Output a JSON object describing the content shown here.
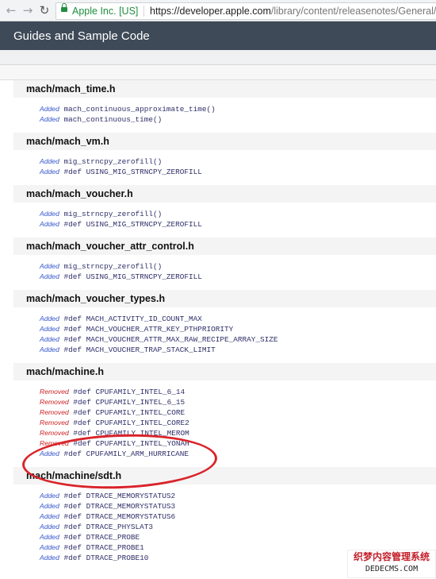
{
  "browser": {
    "secure_label": "Apple Inc. [US]",
    "url_scheme": "https://",
    "url_host": "developer.apple.com",
    "url_rest": "/library/content/releasenotes/General/A",
    "icons": {
      "back": "back-arrow-icon",
      "forward": "forward-arrow-icon",
      "reload": "reload-icon",
      "lock": "lock-icon"
    }
  },
  "header": {
    "title": "Guides and Sample Code"
  },
  "sections": [
    {
      "title": "mach/mach_time.h",
      "entries": [
        {
          "status": "Added",
          "text": "mach_continuous_approximate_time()"
        },
        {
          "status": "Added",
          "text": "mach_continuous_time()"
        }
      ]
    },
    {
      "title": "mach/mach_vm.h",
      "entries": [
        {
          "status": "Added",
          "text": "mig_strncpy_zerofill()"
        },
        {
          "status": "Added",
          "text": "#def USING_MIG_STRNCPY_ZEROFILL"
        }
      ]
    },
    {
      "title": "mach/mach_voucher.h",
      "entries": [
        {
          "status": "Added",
          "text": "mig_strncpy_zerofill()"
        },
        {
          "status": "Added",
          "text": "#def USING_MIG_STRNCPY_ZEROFILL"
        }
      ]
    },
    {
      "title": "mach/mach_voucher_attr_control.h",
      "entries": [
        {
          "status": "Added",
          "text": "mig_strncpy_zerofill()"
        },
        {
          "status": "Added",
          "text": "#def USING_MIG_STRNCPY_ZEROFILL"
        }
      ]
    },
    {
      "title": "mach/mach_voucher_types.h",
      "entries": [
        {
          "status": "Added",
          "text": "#def MACH_ACTIVITY_ID_COUNT_MAX"
        },
        {
          "status": "Added",
          "text": "#def MACH_VOUCHER_ATTR_KEY_PTHPRIORITY"
        },
        {
          "status": "Added",
          "text": "#def MACH_VOUCHER_ATTR_MAX_RAW_RECIPE_ARRAY_SIZE"
        },
        {
          "status": "Added",
          "text": "#def MACH_VOUCHER_TRAP_STACK_LIMIT"
        }
      ]
    },
    {
      "title": "mach/machine.h",
      "entries": [
        {
          "status": "Removed",
          "text": "#def CPUFAMILY_INTEL_6_14"
        },
        {
          "status": "Removed",
          "text": "#def CPUFAMILY_INTEL_6_15"
        },
        {
          "status": "Removed",
          "text": "#def CPUFAMILY_INTEL_CORE"
        },
        {
          "status": "Removed",
          "text": "#def CPUFAMILY_INTEL_CORE2"
        },
        {
          "status": "Removed",
          "text": "#def CPUFAMILY_INTEL_MEROM"
        },
        {
          "status": "Removed",
          "text": "#def CPUFAMILY_INTEL_YONAH"
        },
        {
          "status": "Added",
          "text": "#def CPUFAMILY_ARM_HURRICANE"
        }
      ]
    },
    {
      "title": "mach/machine/sdt.h",
      "entries": [
        {
          "status": "Added",
          "text": "#def DTRACE_MEMORYSTATUS2"
        },
        {
          "status": "Added",
          "text": "#def DTRACE_MEMORYSTATUS3"
        },
        {
          "status": "Added",
          "text": "#def DTRACE_MEMORYSTATUS6"
        },
        {
          "status": "Added",
          "text": "#def DTRACE_PHYSLAT3"
        },
        {
          "status": "Added",
          "text": "#def DTRACE_PROBE"
        },
        {
          "status": "Added",
          "text": "#def DTRACE_PROBE1"
        },
        {
          "status": "Added",
          "text": "#def DTRACE_PROBE10"
        }
      ]
    }
  ],
  "colors": {
    "added": "#3355cc",
    "removed": "#cc2222",
    "annotation": "#d9232a"
  },
  "watermark": {
    "line1": "织梦内容管理系统",
    "line2": "DEDECMS.COM"
  }
}
